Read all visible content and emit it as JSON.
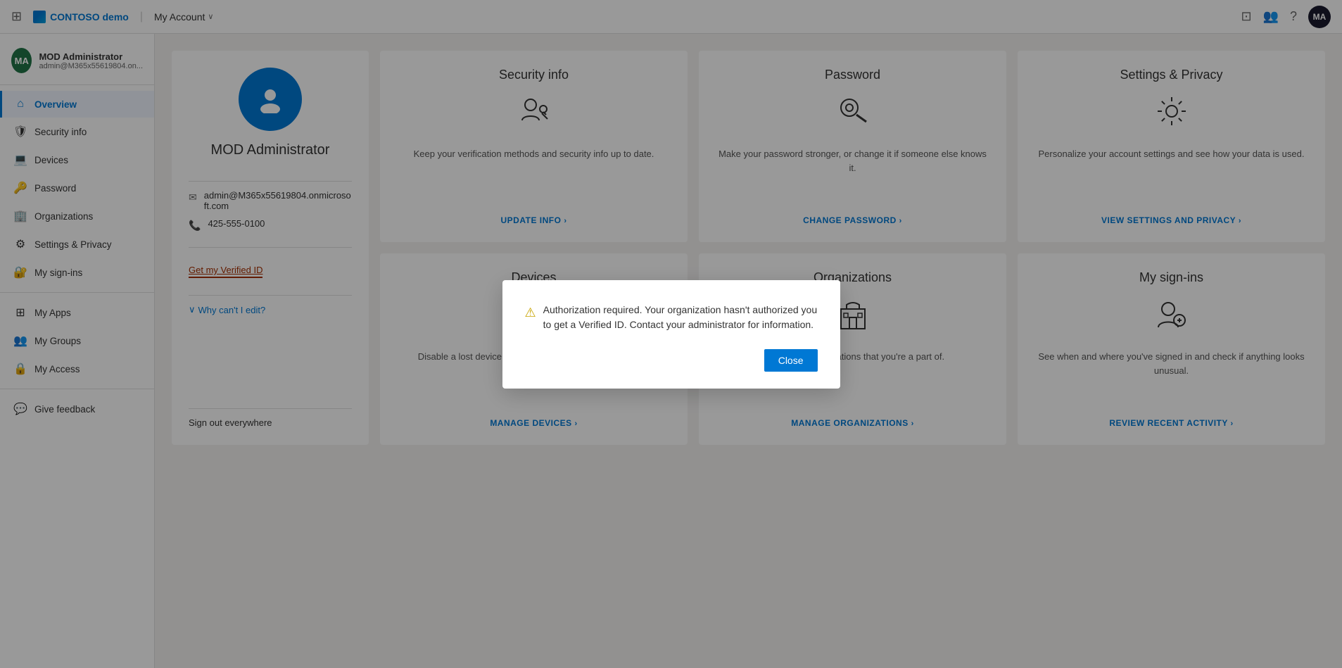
{
  "topbar": {
    "waffle_label": "⊞",
    "brand_name": "CONTOSO demo",
    "title": "My Account",
    "chevron": "∨",
    "icons": [
      "portal-icon",
      "users-icon",
      "help-icon"
    ],
    "avatar_initials": "MA"
  },
  "sidebar": {
    "user": {
      "initials": "MA",
      "name": "MOD Administrator",
      "email": "admin@M365x55619804.on..."
    },
    "items": [
      {
        "id": "overview",
        "label": "Overview",
        "icon": "home",
        "active": true
      },
      {
        "id": "security-info",
        "label": "Security info",
        "icon": "shield"
      },
      {
        "id": "devices",
        "label": "Devices",
        "icon": "laptop"
      },
      {
        "id": "password",
        "label": "Password",
        "icon": "key"
      },
      {
        "id": "organizations",
        "label": "Organizations",
        "icon": "building"
      },
      {
        "id": "settings-privacy",
        "label": "Settings & Privacy",
        "icon": "gear"
      },
      {
        "id": "my-sign-ins",
        "label": "My sign-ins",
        "icon": "person-key"
      },
      {
        "id": "my-apps",
        "label": "My Apps",
        "icon": "grid"
      },
      {
        "id": "my-groups",
        "label": "My Groups",
        "icon": "group"
      },
      {
        "id": "my-access",
        "label": "My Access",
        "icon": "lock"
      },
      {
        "id": "give-feedback",
        "label": "Give feedback",
        "icon": "feedback"
      }
    ]
  },
  "profile_card": {
    "avatar_icon": "👤",
    "name": "MOD Administrator",
    "email": "admin@M365x55619804.onmicrosoft.com",
    "phone": "425-555-0100",
    "get_verified_label": "Get my Verified ID",
    "why_edit_label": "Why can't I edit?",
    "sign_out_label": "Sign out everywhere"
  },
  "info_cards": [
    {
      "id": "security-info",
      "title": "Security info",
      "icon": "✏️👤",
      "description": "Keep your verification methods and security info up to date.",
      "link_label": "UPDATE INFO",
      "link_arrow": "›"
    },
    {
      "id": "password",
      "title": "Password",
      "icon": "🔑",
      "description": "Make your password stronger, or change it if someone else knows it.",
      "link_label": "CHANGE PASSWORD",
      "link_arrow": "›"
    },
    {
      "id": "settings-privacy",
      "title": "Settings & Privacy",
      "icon": "⚙️",
      "description": "Personalize your account settings and see how your data is used.",
      "link_label": "VIEW SETTINGS AND PRIVACY",
      "link_arrow": "›"
    },
    {
      "id": "devices",
      "title": "Devices",
      "icon": "💻",
      "description": "Disable a lost device and review your connected devices.",
      "link_label": "MANAGE DEVICES",
      "link_arrow": "›"
    },
    {
      "id": "organizations",
      "title": "Organizations",
      "icon": "🏢",
      "description": "See all the organizations that you're a part of.",
      "link_label": "MANAGE ORGANIZATIONS",
      "link_arrow": "›"
    },
    {
      "id": "my-sign-ins",
      "title": "My sign-ins",
      "icon": "🔐",
      "description": "See when and where you've signed in and check if anything looks unusual.",
      "link_label": "REVIEW RECENT ACTIVITY",
      "link_arrow": "›"
    }
  ],
  "dialog": {
    "warning_icon": "⚠",
    "message": "Authorization required. Your organization hasn't authorized you to get a Verified ID. Contact your administrator for information.",
    "close_label": "Close"
  }
}
